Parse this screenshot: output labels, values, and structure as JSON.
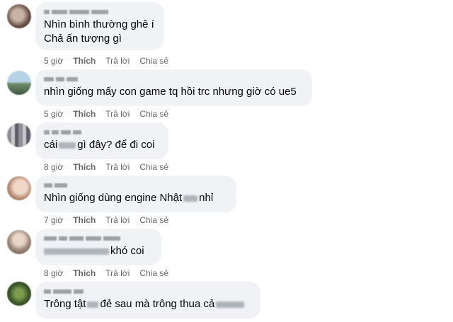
{
  "comments": [
    {
      "lines": [
        [
          "Nhìn bình thường ghê í"
        ],
        [
          "Chả ấn tượng gì"
        ]
      ],
      "time": "5 giờ",
      "like": "Thích",
      "reply": "Trả lời",
      "share": "Chia sẻ"
    },
    {
      "lines": [
        [
          "nhìn giống mấy con game tq hồi trc nhưng giờ có ue5"
        ]
      ],
      "time": "5 giờ",
      "like": "Thích",
      "reply": "Trả lời",
      "share": "Chia sẻ"
    },
    {
      "lines": [
        [
          "cái",
          "gì đây? để đi coi"
        ]
      ],
      "time": "8 giờ",
      "like": "Thích",
      "reply": "Trả lời",
      "share": "Chia sẻ"
    },
    {
      "lines": [
        [
          "Nhìn giống dùng engine Nhật",
          "nhỉ"
        ]
      ],
      "time": "7 giờ",
      "like": "Thích",
      "reply": "Trả lời",
      "share": "Chia sẻ"
    },
    {
      "lines": [
        [
          "",
          "khó coi"
        ]
      ],
      "time": "8 giờ",
      "like": "Thích",
      "reply": "Trả lời",
      "share": "Chia sẻ"
    },
    {
      "lines": [
        [
          "Trông tật",
          "đẻ sau mà trông thua cả"
        ]
      ],
      "time": "",
      "like": "",
      "reply": "",
      "share": ""
    }
  ]
}
